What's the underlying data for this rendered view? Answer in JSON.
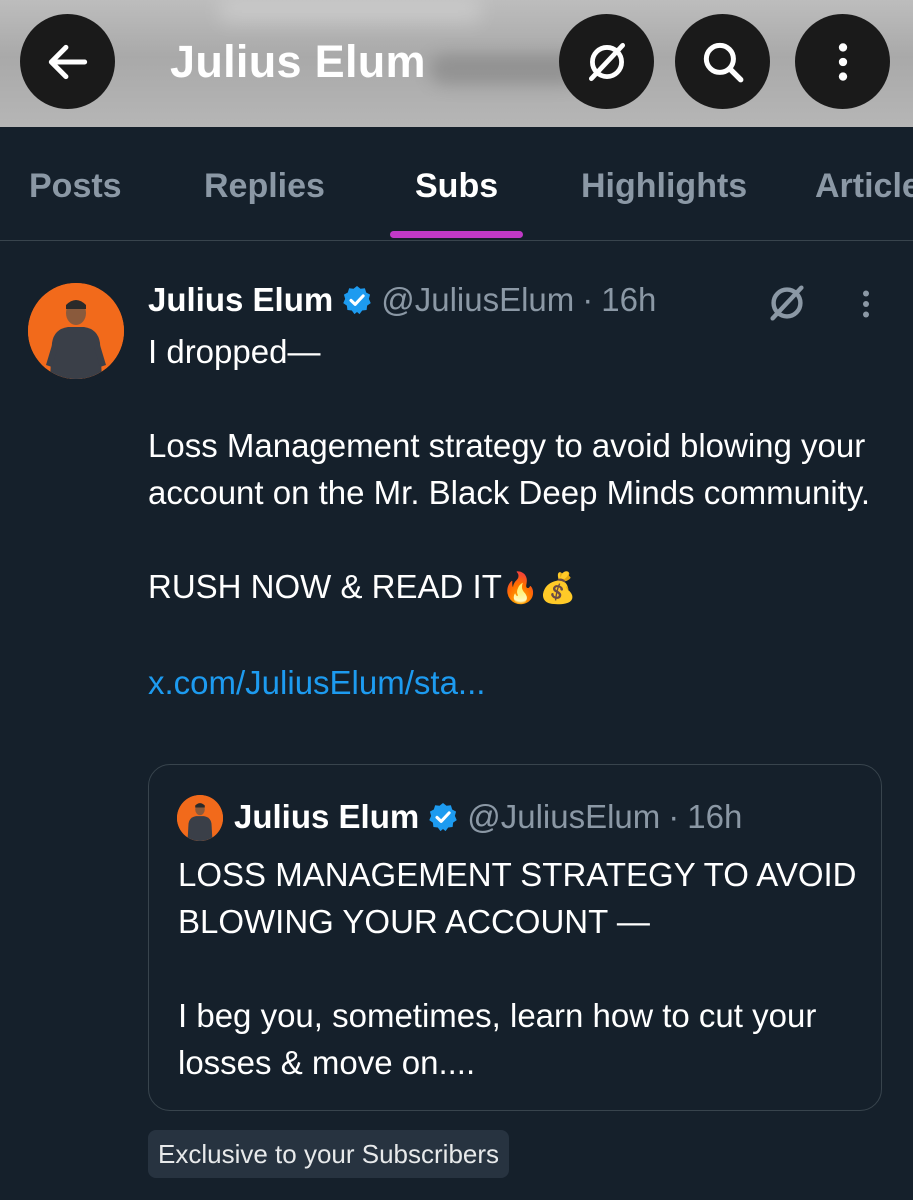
{
  "header": {
    "title": "Julius Elum",
    "back_icon": "arrow-left-icon",
    "unsubscribe_icon": "slashed-circle-icon",
    "search_icon": "search-icon",
    "more_icon": "more-vertical-icon"
  },
  "tabs": [
    {
      "label": "Posts",
      "active": false
    },
    {
      "label": "Replies",
      "active": false
    },
    {
      "label": "Subs",
      "active": true
    },
    {
      "label": "Highlights",
      "active": false
    },
    {
      "label": "Articles",
      "active": false
    }
  ],
  "post": {
    "author_name": "Julius Elum",
    "handle": "@JuliusElum",
    "separator": "·",
    "time": "16h",
    "paragraphs": [
      "I dropped—",
      "Loss Management strategy to avoid blowing your account on the Mr. Black Deep Minds community.",
      "RUSH NOW & READ IT",
      "x.com/JuliusElum/sta..."
    ],
    "emojis": "🔥💰",
    "quote": {
      "author_name": "Julius Elum",
      "handle": "@JuliusElum",
      "separator": "·",
      "time": "16h",
      "paragraphs": [
        "LOSS MANAGEMENT STRATEGY TO AVOID BLOWING YOUR ACCOUNT —",
        "I beg you, sometimes, learn how to cut your losses & move on...."
      ]
    },
    "badge": "Exclusive to your Subscribers"
  },
  "colors": {
    "background": "#15202b",
    "accent_tab": "#c039c7",
    "link": "#1d9bf0",
    "avatar_bg": "#f26a1b",
    "verified": "#1d9bf0"
  }
}
